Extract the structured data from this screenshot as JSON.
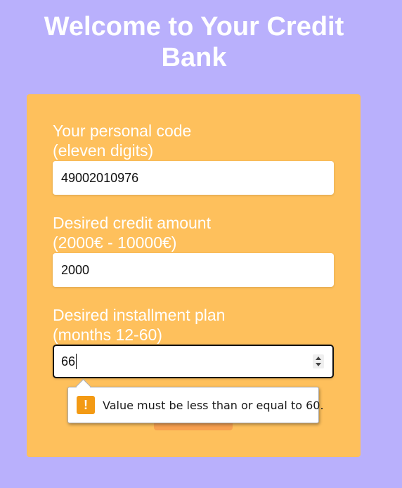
{
  "page": {
    "title_line1": "Welcome to Your Credit",
    "title_line2": "Bank"
  },
  "form": {
    "personal_code": {
      "label_line1": "Your personal code",
      "label_line2": "(eleven digits)",
      "value": "49002010976"
    },
    "credit_amount": {
      "label_line1": "Desired credit amount",
      "label_line2": "(2000€ - 10000€)",
      "value": "2000"
    },
    "installment_plan": {
      "label_line1": "Desired installment plan",
      "label_line2": "(months 12-60)",
      "value": "66"
    }
  },
  "validation": {
    "icon": "!",
    "message": "Value must be less than or equal to 60."
  },
  "colors": {
    "background": "#b9b0fc",
    "card": "#fec05c",
    "warning": "#f39a14",
    "submit": "#f7a050"
  }
}
